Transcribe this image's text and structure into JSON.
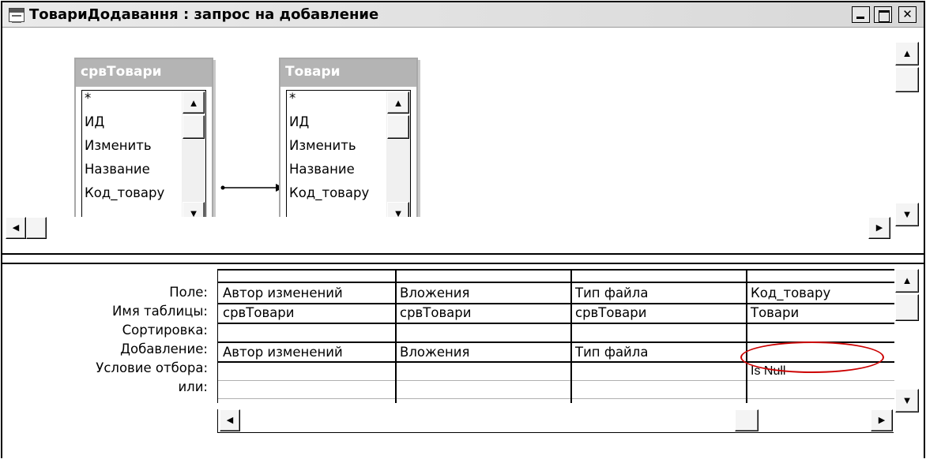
{
  "window": {
    "title": "ТовариДодавання : запрос на добавление",
    "controls": {
      "minimize": "",
      "maximize": "",
      "close": ""
    }
  },
  "tables": [
    {
      "name": "срвТовари",
      "fields": [
        "*",
        "ИД",
        "Изменить",
        "Название",
        "Код_товару"
      ]
    },
    {
      "name": "Товари",
      "fields": [
        "*",
        "ИД",
        "Изменить",
        "Название",
        "Код_товару"
      ]
    }
  ],
  "join": {
    "from": "Код_товару",
    "to": "Код_товару"
  },
  "grid": {
    "row_labels": [
      "Поле:",
      "Имя таблицы:",
      "Сортировка:",
      "Добавление:",
      "Условие отбора:",
      "или:"
    ],
    "columns": [
      {
        "field": "Автор изменений",
        "table": "срвТовари",
        "sort": "",
        "append": "Автор изменений",
        "criteria": "",
        "or": ""
      },
      {
        "field": "Вложения",
        "table": "срвТовари",
        "sort": "",
        "append": "Вложения",
        "criteria": "",
        "or": ""
      },
      {
        "field": "Тип файла",
        "table": "срвТовари",
        "sort": "",
        "append": "Тип файла",
        "criteria": "",
        "or": ""
      },
      {
        "field": "Код_товару",
        "table": "Товари",
        "sort": "",
        "append": "",
        "criteria": "Is Null",
        "or": ""
      }
    ]
  },
  "highlight": {
    "color": "#cc0000",
    "target": "append-cell-column-4"
  },
  "icons": {
    "scroll_up": "▲",
    "scroll_down": "▼",
    "scroll_left": "◀",
    "scroll_right": "▶"
  }
}
